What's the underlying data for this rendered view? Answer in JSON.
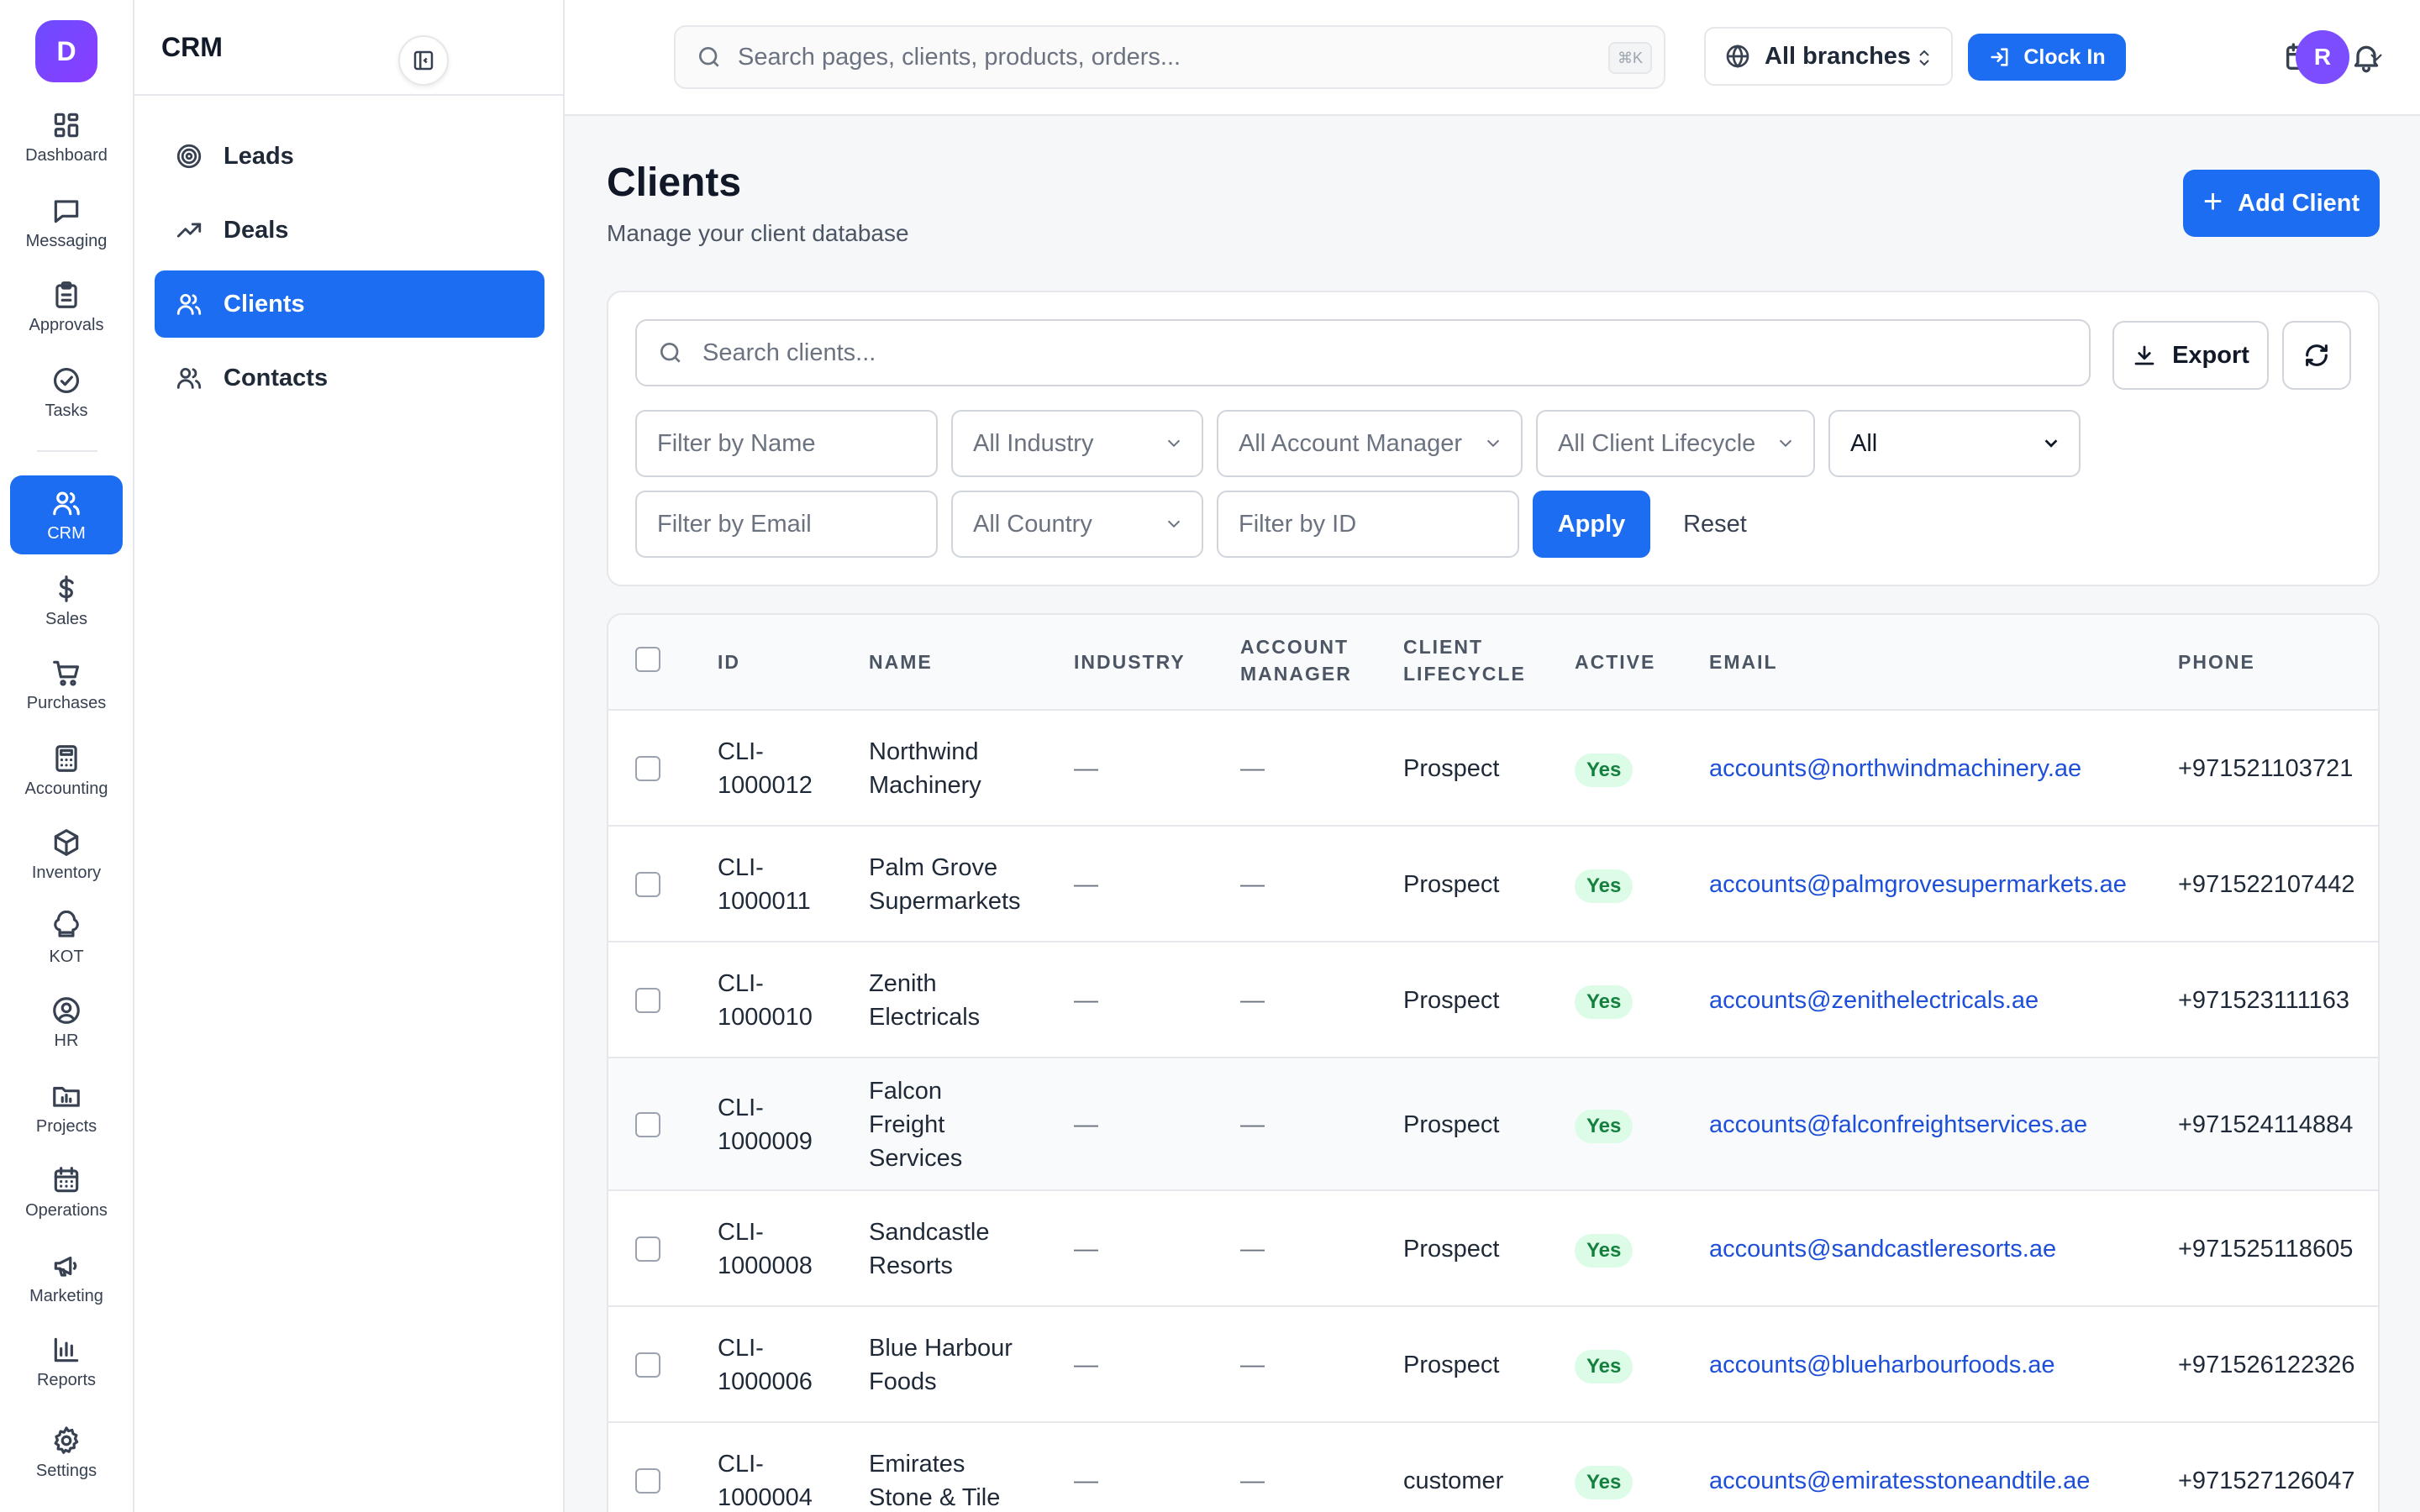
{
  "rail": {
    "logo": "D",
    "items": [
      {
        "label": "Dashboard",
        "icon": "grid-icon"
      },
      {
        "label": "Messaging",
        "icon": "chat-icon"
      },
      {
        "label": "Approvals",
        "icon": "clipboard-icon"
      },
      {
        "label": "Tasks",
        "icon": "check-circle-icon"
      },
      {
        "label": "CRM",
        "icon": "users-icon"
      },
      {
        "label": "Sales",
        "icon": "dollar-icon"
      },
      {
        "label": "Purchases",
        "icon": "cart-icon"
      },
      {
        "label": "Accounting",
        "icon": "calculator-icon"
      },
      {
        "label": "Inventory",
        "icon": "box-icon"
      },
      {
        "label": "KOT",
        "icon": "chef-hat-icon"
      },
      {
        "label": "HR",
        "icon": "user-circle-icon"
      },
      {
        "label": "Projects",
        "icon": "folder-chart-icon"
      },
      {
        "label": "Operations",
        "icon": "calendar-grid-icon"
      },
      {
        "label": "Marketing",
        "icon": "megaphone-icon"
      },
      {
        "label": "Reports",
        "icon": "bar-chart-icon"
      },
      {
        "label": "Settings",
        "icon": "gear-icon"
      }
    ],
    "active": "CRM"
  },
  "submenu": {
    "title": "CRM",
    "items": [
      {
        "label": "Leads",
        "icon": "target-icon"
      },
      {
        "label": "Deals",
        "icon": "trend-up-icon"
      },
      {
        "label": "Clients",
        "icon": "users-icon"
      },
      {
        "label": "Contacts",
        "icon": "users-icon"
      }
    ],
    "active": "Clients"
  },
  "topbar": {
    "search_placeholder": "Search pages, clients, products, orders...",
    "shortcut": "⌘K",
    "branch": "All branches",
    "clock_in": "Clock In",
    "avatar": "R"
  },
  "page": {
    "title": "Clients",
    "subtitle": "Manage your client database",
    "add_button": "Add Client"
  },
  "filters": {
    "search_placeholder": "Search clients...",
    "export_label": "Export",
    "name_placeholder": "Filter by Name",
    "industry": "All Industry",
    "account_manager": "All Account Manager",
    "client_lifecycle": "All Client Lifecycle",
    "status_select": "All",
    "email_placeholder": "Filter by Email",
    "country": "All Country",
    "id_placeholder": "Filter by ID",
    "apply": "Apply",
    "reset": "Reset"
  },
  "table": {
    "headers": {
      "id": "ID",
      "name": "NAME",
      "industry": "INDUSTRY",
      "account_manager_1": "ACCOUNT",
      "account_manager_2": "MANAGER",
      "client_lifecycle_1": "CLIENT",
      "client_lifecycle_2": "LIFECYCLE",
      "active": "ACTIVE",
      "email": "EMAIL",
      "phone": "PHONE"
    },
    "rows": [
      {
        "id1": "CLI-",
        "id2": "1000012",
        "name": [
          "Northwind",
          "Machinery"
        ],
        "industry": "—",
        "manager": "—",
        "lifecycle": "Prospect",
        "active": "Yes",
        "email": "accounts@northwindmachinery.ae",
        "phone": "+971521103721"
      },
      {
        "id1": "CLI-",
        "id2": "1000011",
        "name": [
          "Palm Grove",
          "Supermarkets"
        ],
        "industry": "—",
        "manager": "—",
        "lifecycle": "Prospect",
        "active": "Yes",
        "email": "accounts@palmgrovesupermarkets.ae",
        "phone": "+971522107442"
      },
      {
        "id1": "CLI-",
        "id2": "1000010",
        "name": [
          "Zenith",
          "Electricals"
        ],
        "industry": "—",
        "manager": "—",
        "lifecycle": "Prospect",
        "active": "Yes",
        "email": "accounts@zenithelectricals.ae",
        "phone": "+971523111163"
      },
      {
        "id1": "CLI-",
        "id2": "1000009",
        "name": [
          "Falcon",
          "Freight",
          "Services"
        ],
        "industry": "—",
        "manager": "—",
        "lifecycle": "Prospect",
        "active": "Yes",
        "email": "accounts@falconfreightservices.ae",
        "phone": "+971524114884"
      },
      {
        "id1": "CLI-",
        "id2": "1000008",
        "name": [
          "Sandcastle",
          "Resorts"
        ],
        "industry": "—",
        "manager": "—",
        "lifecycle": "Prospect",
        "active": "Yes",
        "email": "accounts@sandcastleresorts.ae",
        "phone": "+971525118605"
      },
      {
        "id1": "CLI-",
        "id2": "1000006",
        "name": [
          "Blue Harbour",
          "Foods"
        ],
        "industry": "—",
        "manager": "—",
        "lifecycle": "Prospect",
        "active": "Yes",
        "email": "accounts@blueharbourfoods.ae",
        "phone": "+971526122326"
      },
      {
        "id1": "CLI-",
        "id2": "1000004",
        "name": [
          "Emirates",
          "Stone & Tile"
        ],
        "industry": "—",
        "manager": "—",
        "lifecycle": "customer",
        "active": "Yes",
        "email": "accounts@emiratesstoneandtile.ae",
        "phone": "+971527126047"
      }
    ]
  },
  "colors": {
    "accent": "#1d6df2",
    "badge_bg": "#dcfce7",
    "badge_text": "#15803d",
    "email_link": "#1d4fd8"
  }
}
